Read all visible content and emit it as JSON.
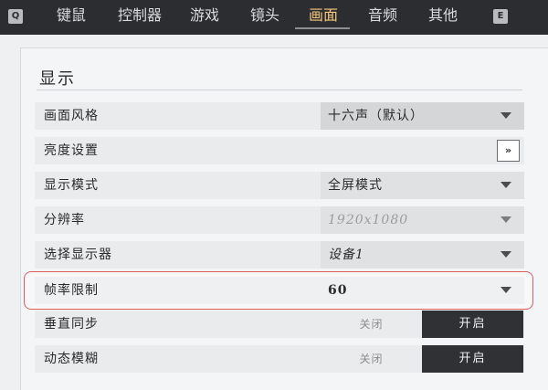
{
  "topbar": {
    "key_left": "Q",
    "key_right": "E",
    "tabs": [
      {
        "label": "键鼠"
      },
      {
        "label": "控制器"
      },
      {
        "label": "游戏"
      },
      {
        "label": "镜头"
      },
      {
        "label": "画面"
      },
      {
        "label": "音频"
      },
      {
        "label": "其他"
      }
    ],
    "active_tab": "画面"
  },
  "section": {
    "title": "显示"
  },
  "settings": [
    {
      "label": "画面风格",
      "type": "dropdown",
      "value": "十六声（默认）"
    },
    {
      "label": "亮度设置",
      "type": "button",
      "button_label": "»"
    },
    {
      "label": "显示模式",
      "type": "dropdown",
      "value": "全屏模式"
    },
    {
      "label": "分辨率",
      "type": "dropdown",
      "value": "1920x1080",
      "disabled": true
    },
    {
      "label": "选择显示器",
      "type": "dropdown",
      "value": "设备1"
    },
    {
      "label": "帧率限制",
      "type": "dropdown",
      "value": "60",
      "highlighted": true
    },
    {
      "label": "垂直同步",
      "type": "toggle",
      "off_label": "关闭",
      "on_label": "开启",
      "selected": "开启"
    },
    {
      "label": "动态模糊",
      "type": "toggle",
      "off_label": "关闭",
      "on_label": "开启",
      "selected": "开启"
    }
  ],
  "colors": {
    "topbar_bg": "#2b2d30",
    "active_tab": "#f3c87a",
    "highlight_border": "#e05a5f",
    "toggle_on_bg": "#2f3134"
  }
}
